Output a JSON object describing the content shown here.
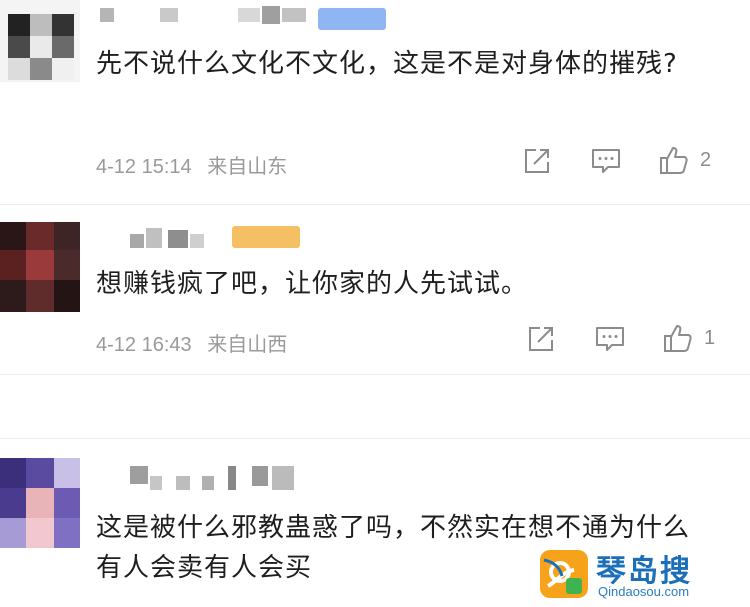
{
  "comments": [
    {
      "text": "先不说什么文化不文化，这是不是对身体的摧残?",
      "date": "4-12 15:14",
      "location": "来自山东",
      "likes": "2",
      "badge_color": "#8fb6f2"
    },
    {
      "text": "想赚钱疯了吧，让你家的人先试试。",
      "date": "4-12 16:43",
      "location": "来自山西",
      "likes": "1",
      "badge_color": "#f5c064"
    },
    {
      "text": "这是被什么邪教蛊惑了吗，不然实在想不通为什么有人会卖有人会买"
    }
  ],
  "icons": [
    "share-icon",
    "comment-icon",
    "like-icon"
  ],
  "watermark": {
    "title": "琴岛搜",
    "url": "Qindaosou.com",
    "accent": "#1b6fb8"
  }
}
